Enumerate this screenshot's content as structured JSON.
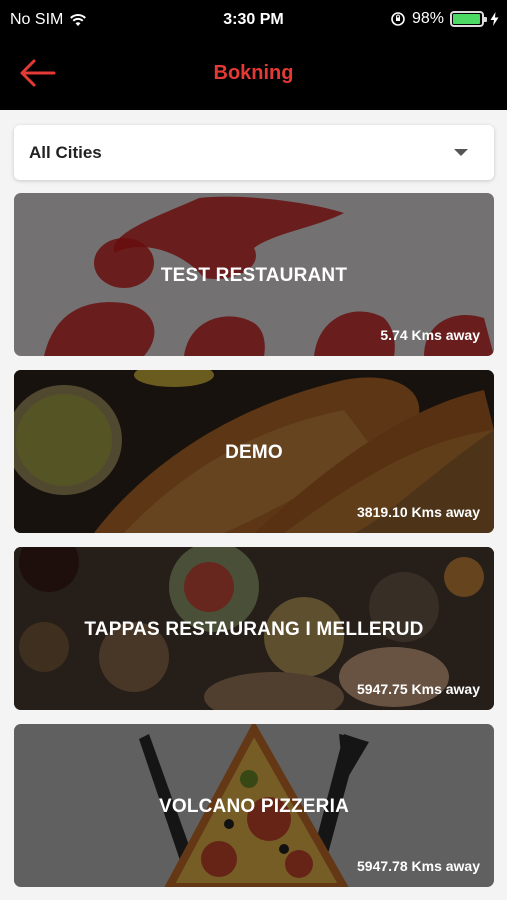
{
  "status_bar": {
    "carrier": "No SIM",
    "time": "3:30 PM",
    "battery": "98%",
    "battery_level": 0.98
  },
  "nav": {
    "title": "Bokning",
    "back_icon": "arrow-left-icon",
    "accent_color": "#e53935"
  },
  "city_filter": {
    "selected": "All Cities"
  },
  "restaurants": [
    {
      "name": "TEST RESTAURANT",
      "distance": "5.74 Kms away"
    },
    {
      "name": "DEMO",
      "distance": "3819.10 Kms away"
    },
    {
      "name": "TAPPAS RESTAURANG I MELLERUD",
      "distance": "5947.75 Kms away"
    },
    {
      "name": "VOLCANO PIZZERIA",
      "distance": "5947.78 Kms away"
    }
  ]
}
